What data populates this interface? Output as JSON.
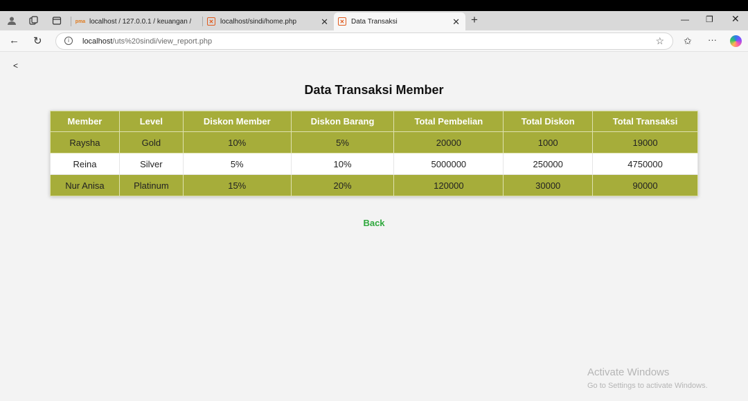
{
  "browser": {
    "tabs": [
      {
        "title": "localhost / 127.0.0.1 / keuangan /",
        "favicon": "phpmyadmin-icon"
      },
      {
        "title": "localhost/sindi/home.php",
        "favicon": "xampp-icon"
      },
      {
        "title": "Data Transaksi",
        "favicon": "xampp-icon"
      }
    ],
    "url_host": "localhost",
    "url_path": "/uts%20sindi/view_report.php"
  },
  "page": {
    "back_arrow": "<",
    "title": "Data Transaksi Member",
    "columns": [
      "Member",
      "Level",
      "Diskon Member",
      "Diskon Barang",
      "Total Pembelian",
      "Total Diskon",
      "Total Transaksi"
    ],
    "rows": [
      [
        "Raysha",
        "Gold",
        "10%",
        "5%",
        "20000",
        "1000",
        "19000"
      ],
      [
        "Reina",
        "Silver",
        "5%",
        "10%",
        "5000000",
        "250000",
        "4750000"
      ],
      [
        "Nur Anisa",
        "Platinum",
        "15%",
        "20%",
        "120000",
        "30000",
        "90000"
      ]
    ],
    "back_label": "Back"
  },
  "watermark": {
    "line1": "Activate Windows",
    "line2": "Go to Settings to activate Windows."
  },
  "colors": {
    "header_bg": "#a6ad3a",
    "link": "#2fa83d"
  }
}
